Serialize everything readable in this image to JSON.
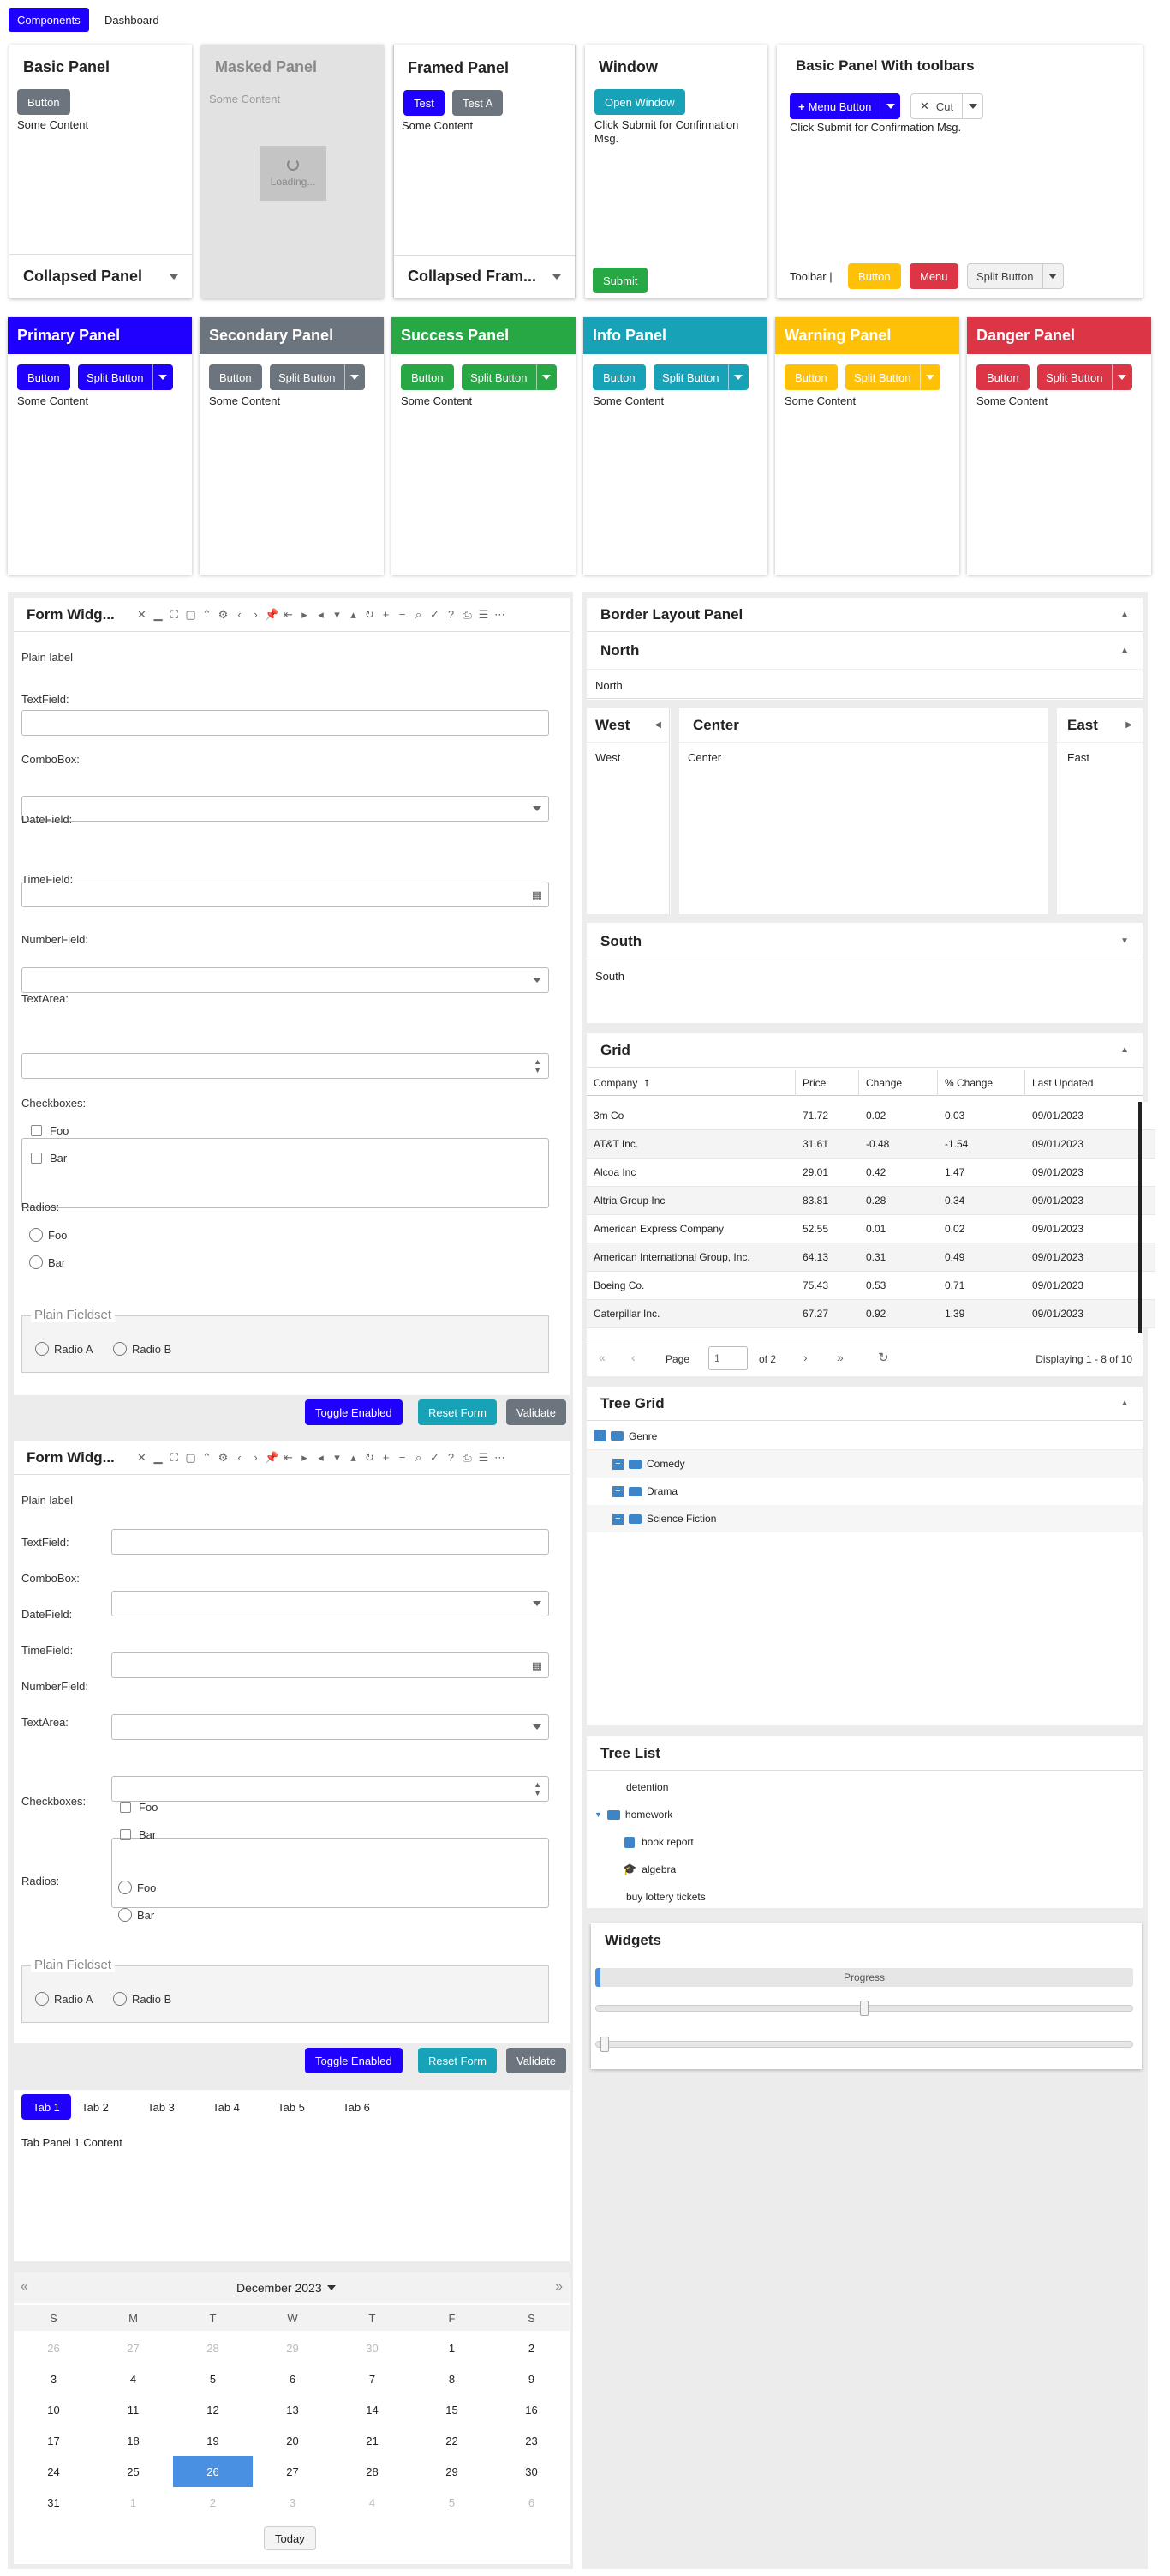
{
  "colors": {
    "primary": "#1f00ff",
    "secondary": "#6c757d",
    "success": "#28a745",
    "info": "#17a2b8",
    "warning": "#ffc107",
    "danger": "#dc3545",
    "selected_day": "#4a90e2"
  },
  "topbar": {
    "components": "Components",
    "dashboard": "Dashboard"
  },
  "basic_panel": {
    "title": "Basic Panel",
    "button": "Button",
    "content": "Some Content",
    "collapsed_title": "Collapsed Panel"
  },
  "masked_panel": {
    "title": "Masked Panel",
    "content": "Some Content",
    "loading": "Loading..."
  },
  "framed_panel": {
    "title": "Framed Panel",
    "btn_test": "Test",
    "btn_test_a": "Test A",
    "content": "Some Content",
    "collapsed_title": "Collapsed Fram..."
  },
  "window_panel": {
    "title": "Window",
    "open": "Open Window",
    "msg": "Click Submit for Confirmation Msg.",
    "submit": "Submit"
  },
  "toolbar_panel": {
    "title": "Basic Panel With toolbars",
    "menu_button": "Menu Button",
    "cut": "Cut",
    "msg": "Click Submit for Confirmation Msg.",
    "toolbar_label": "Toolbar |",
    "button": "Button",
    "menu": "Menu",
    "split_button": "Split Button"
  },
  "color_panels": [
    {
      "title": "Primary Panel",
      "button": "Button",
      "split": "Split Button",
      "content": "Some Content"
    },
    {
      "title": "Secondary Panel",
      "button": "Button",
      "split": "Split Button",
      "content": "Some Content"
    },
    {
      "title": "Success Panel",
      "button": "Button",
      "split": "Split Button",
      "content": "Some Content"
    },
    {
      "title": "Info Panel",
      "button": "Button",
      "split": "Split Button",
      "content": "Some Content"
    },
    {
      "title": "Warning Panel",
      "button": "Button",
      "split": "Split Button",
      "content": "Some Content"
    },
    {
      "title": "Danger Panel",
      "button": "Button",
      "split": "Split Button",
      "content": "Some Content"
    }
  ],
  "form1": {
    "title": "Form Widg...",
    "plain_label": "Plain label",
    "textfield": "TextField:",
    "combobox": "ComboBox:",
    "datefield": "DateField:",
    "timefield": "TimeField:",
    "numberfield": "NumberField:",
    "textarea": "TextArea:",
    "checkboxes": "Checkboxes:",
    "foo": "Foo",
    "bar": "Bar",
    "radios": "Radios:",
    "fieldset": "Plain Fieldset",
    "radio_a": "Radio A",
    "radio_b": "Radio B",
    "toggle": "Toggle Enabled",
    "reset": "Reset Form",
    "validate": "Validate"
  },
  "form2": {
    "title": "Form Widg...",
    "plain_label": "Plain label",
    "textfield": "TextField:",
    "combobox": "ComboBox:",
    "datefield": "DateField:",
    "timefield": "TimeField:",
    "numberfield": "NumberField:",
    "textarea": "TextArea:",
    "checkboxes": "Checkboxes:",
    "foo": "Foo",
    "bar": "Bar",
    "radios": "Radios:",
    "fieldset": "Plain Fieldset",
    "radio_a": "Radio A",
    "radio_b": "Radio B",
    "toggle": "Toggle Enabled",
    "reset": "Reset Form",
    "validate": "Validate"
  },
  "tabs": {
    "items": [
      "Tab 1",
      "Tab 2",
      "Tab 3",
      "Tab 4",
      "Tab 5",
      "Tab 6"
    ],
    "content": "Tab Panel 1 Content"
  },
  "calendar": {
    "month": "December 2023",
    "weekdays": [
      "S",
      "M",
      "T",
      "W",
      "T",
      "F",
      "S"
    ],
    "weeks": [
      [
        "26",
        "27",
        "28",
        "29",
        "30",
        "1",
        "2"
      ],
      [
        "3",
        "4",
        "5",
        "6",
        "7",
        "8",
        "9"
      ],
      [
        "10",
        "11",
        "12",
        "13",
        "14",
        "15",
        "16"
      ],
      [
        "17",
        "18",
        "19",
        "20",
        "21",
        "22",
        "23"
      ],
      [
        "24",
        "25",
        "26",
        "27",
        "28",
        "29",
        "30"
      ],
      [
        "31",
        "1",
        "2",
        "3",
        "4",
        "5",
        "6"
      ]
    ],
    "selected": "26",
    "today": "Today"
  },
  "border_layout": {
    "title": "Border Layout Panel",
    "north": "North",
    "north_content": "North",
    "west": "West",
    "west_content": "West",
    "center": "Center",
    "center_content": "Center",
    "east": "East",
    "east_content": "East",
    "south": "South",
    "south_content": "South"
  },
  "grid": {
    "title": "Grid",
    "columns": [
      "Company",
      "Price",
      "Change",
      "% Change",
      "Last Updated"
    ],
    "rows": [
      [
        "3m Co",
        "71.72",
        "0.02",
        "0.03",
        "09/01/2023"
      ],
      [
        "AT&T Inc.",
        "31.61",
        "-0.48",
        "-1.54",
        "09/01/2023"
      ],
      [
        "Alcoa Inc",
        "29.01",
        "0.42",
        "1.47",
        "09/01/2023"
      ],
      [
        "Altria Group Inc",
        "83.81",
        "0.28",
        "0.34",
        "09/01/2023"
      ],
      [
        "American Express Company",
        "52.55",
        "0.01",
        "0.02",
        "09/01/2023"
      ],
      [
        "American International Group, Inc.",
        "64.13",
        "0.31",
        "0.49",
        "09/01/2023"
      ],
      [
        "Boeing Co.",
        "75.43",
        "0.53",
        "0.71",
        "09/01/2023"
      ],
      [
        "Caterpillar Inc.",
        "67.27",
        "0.92",
        "1.39",
        "09/01/2023"
      ]
    ],
    "page_label": "Page",
    "page_value": "1",
    "of_pages": "of 2",
    "displaying": "Displaying 1 - 8 of 10"
  },
  "tree_grid": {
    "title": "Tree Grid",
    "root": "Genre",
    "children": [
      "Comedy",
      "Drama",
      "Science Fiction"
    ]
  },
  "tree_list": {
    "title": "Tree List",
    "items": [
      "detention",
      "homework",
      "book report",
      "algebra",
      "buy lottery tickets"
    ]
  },
  "widgets": {
    "title": "Widgets",
    "progress_label": "Progress",
    "progress": 0.01,
    "slider1": 0.5,
    "slider2": 0.01
  }
}
